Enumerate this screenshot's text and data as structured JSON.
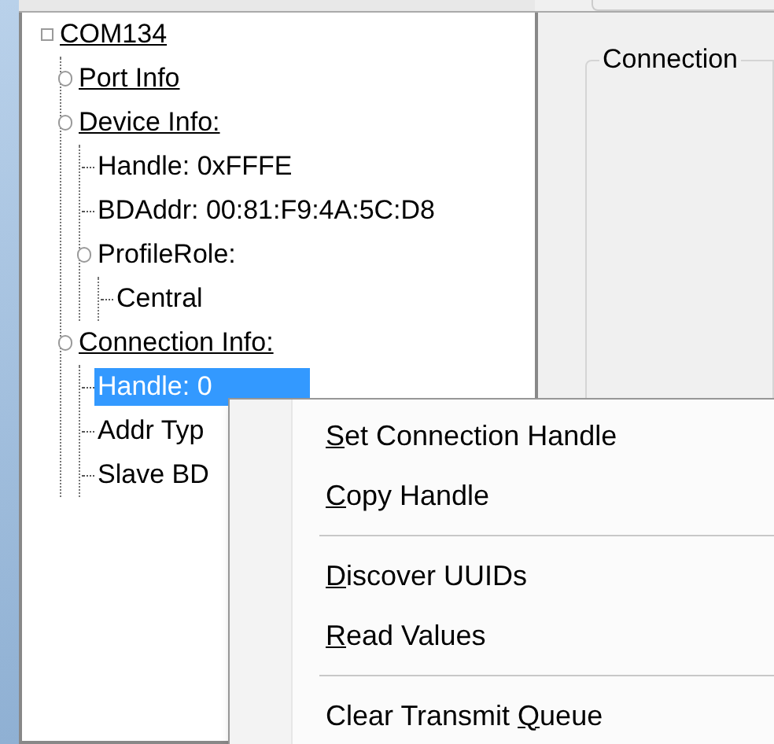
{
  "tree": [
    {
      "label": "COM134",
      "underlined": true,
      "kind": "root",
      "selected": false,
      "children": [
        {
          "label": "Port Info",
          "underlined": true,
          "kind": "branch",
          "selected": false
        },
        {
          "label": "Device Info:",
          "underlined": true,
          "kind": "branch",
          "selected": false,
          "children": [
            {
              "label": "Handle: 0xFFFE",
              "underlined": false,
              "kind": "leaf",
              "selected": false
            },
            {
              "label": "BDAddr: 00:81:F9:4A:5C:D8",
              "underlined": false,
              "kind": "leaf",
              "selected": false
            },
            {
              "label": "ProfileRole:",
              "underlined": false,
              "kind": "branch",
              "selected": false,
              "children": [
                {
                  "label": "Central",
                  "underlined": false,
                  "kind": "leaf",
                  "selected": false
                }
              ]
            }
          ]
        },
        {
          "label": "Connection Info:",
          "underlined": true,
          "kind": "branch",
          "selected": false,
          "children": [
            {
              "label": "Handle: 0",
              "underlined": false,
              "kind": "leaf",
              "selected": true
            },
            {
              "label": "Addr Typ",
              "underlined": false,
              "kind": "leaf",
              "selected": false
            },
            {
              "label": "Slave BD",
              "underlined": false,
              "kind": "leaf",
              "selected": false
            }
          ]
        }
      ]
    }
  ],
  "group_box": {
    "title": "Connection"
  },
  "context_menu": [
    {
      "kind": "item",
      "key": "S",
      "text_after": "et Connection Handle"
    },
    {
      "kind": "item",
      "key": "C",
      "text_after": "opy Handle"
    },
    {
      "kind": "separator"
    },
    {
      "kind": "item",
      "key": "D",
      "text_after": "iscover UUIDs"
    },
    {
      "kind": "item",
      "key": "R",
      "text_after": "ead Values"
    },
    {
      "kind": "separator"
    },
    {
      "kind": "item",
      "text_before": "Clear Transmit ",
      "key": "Q",
      "text_after": "ueue"
    }
  ]
}
